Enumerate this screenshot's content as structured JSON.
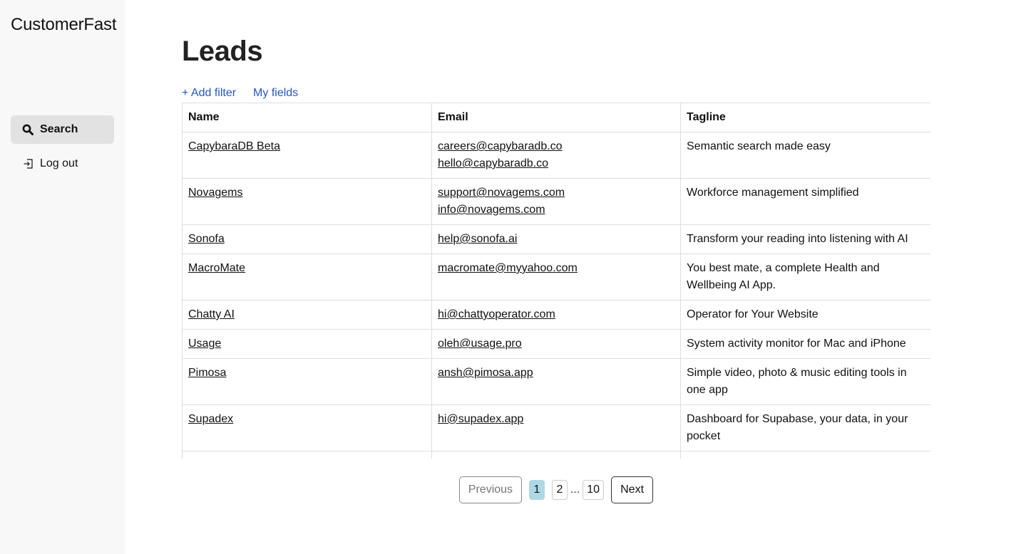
{
  "sidebar": {
    "brand": "CustomerFast",
    "items": [
      {
        "label": "Search",
        "icon": "search-icon",
        "active": true
      },
      {
        "label": "Log out",
        "icon": "logout-icon",
        "active": false
      }
    ]
  },
  "main": {
    "title": "Leads",
    "toolbar": {
      "add_filter": "+ Add filter",
      "my_fields": "My fields"
    },
    "table": {
      "headers": [
        "Name",
        "Email",
        "Tagline"
      ],
      "rows": [
        {
          "name": "CapybaraDB Beta",
          "emails": [
            "careers@capybaradb.co",
            "hello@capybaradb.co"
          ],
          "tagline": "Semantic search made easy"
        },
        {
          "name": "Novagems",
          "emails": [
            "support@novagems.com",
            "info@novagems.com"
          ],
          "tagline": "Workforce management simplified"
        },
        {
          "name": "Sonofa",
          "emails": [
            "help@sonofa.ai"
          ],
          "tagline": "Transform your reading into listening with AI"
        },
        {
          "name": "MacroMate",
          "emails": [
            "macromate@myyahoo.com"
          ],
          "tagline": "You best mate, a complete Health and Wellbeing AI App."
        },
        {
          "name": "Chatty AI",
          "emails": [
            "hi@chattyoperator.com"
          ],
          "tagline": "Operator for Your Website"
        },
        {
          "name": "Usage",
          "emails": [
            "oleh@usage.pro"
          ],
          "tagline": "System activity monitor for Mac and iPhone"
        },
        {
          "name": "Pimosa",
          "emails": [
            "ansh@pimosa.app"
          ],
          "tagline": "Simple video, photo & music editing tools in one app"
        },
        {
          "name": "Supadex",
          "emails": [
            "hi@supadex.app"
          ],
          "tagline": "Dashboard for Supabase, your data, in your pocket"
        },
        {
          "name": "",
          "emails": [],
          "tagline": ""
        }
      ]
    },
    "pagination": {
      "previous": "Previous",
      "next": "Next",
      "pages": [
        "1",
        "2"
      ],
      "ellipsis": "...",
      "last": "10",
      "current": "1"
    }
  },
  "colors": {
    "sidebar_bg": "#f8f8f8",
    "active_nav_bg": "#e2e2e2",
    "link": "#2255d6",
    "current_page": "#add8e6"
  }
}
